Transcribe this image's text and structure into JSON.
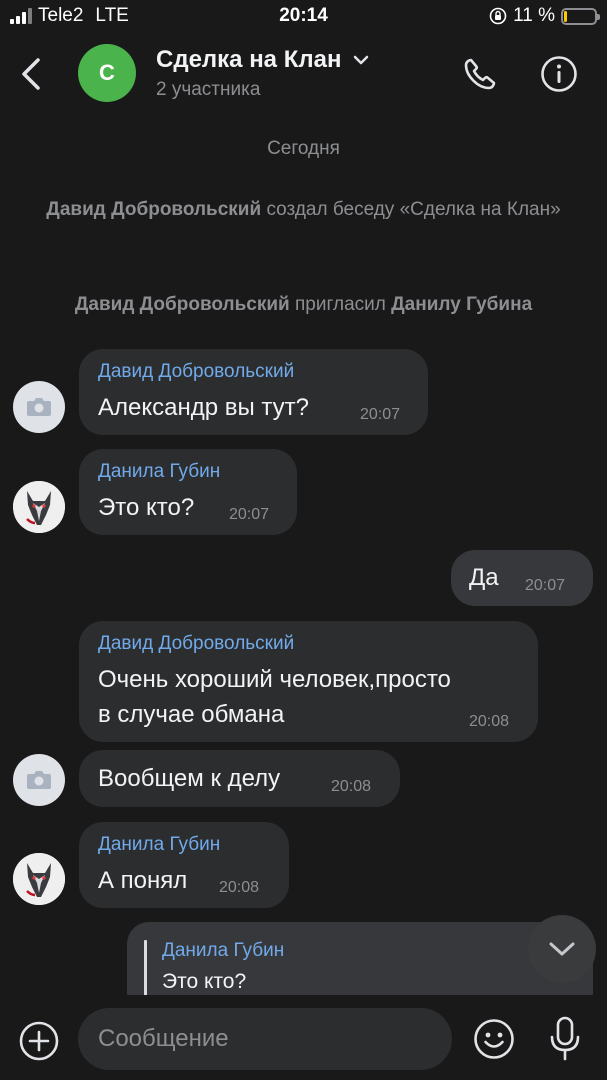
{
  "status_bar": {
    "carrier": "Tele2",
    "network": "LTE",
    "time": "20:14",
    "battery": "11 %",
    "battery_level": 0.11
  },
  "header": {
    "avatar_letter": "С",
    "title": "Сделка на Клан",
    "subtitle": "2 участника"
  },
  "system": {
    "date": "Сегодня",
    "created_actor": "Давид Добровольский",
    "created_text": "создал беседу «Сделка на Клан»",
    "invite_actor": "Давид Добровольский",
    "invite_text": "пригласил",
    "invite_target": "Данилу Губина"
  },
  "messages": [
    {
      "author": "Давид Добровольский",
      "text": "Александр вы тут?",
      "time": "20:07"
    },
    {
      "author": "Данила Губин",
      "text": "Это кто?",
      "time": "20:07"
    },
    {
      "author": "",
      "text": "Да",
      "time": "20:07"
    },
    {
      "author": "Давид Добровольский",
      "text": "Очень хороший человек,просто",
      "text2": "в случае обмана",
      "time": "20:08"
    },
    {
      "author": "",
      "text": "Вообщем к делу",
      "time": "20:08"
    },
    {
      "author": "Данила Губин",
      "text": "А понял",
      "time": "20:08"
    }
  ],
  "reply_preview": {
    "author": "Данила Губин",
    "text": "Это кто?"
  },
  "composer": {
    "placeholder": "Сообщение"
  },
  "colors": {
    "background": "#19191a",
    "bubble": "#2c2d2f",
    "author_link": "#71aaeb",
    "chat_avatar": "#4bb34b"
  },
  "icons": [
    "back-arrow-icon",
    "chevron-down-icon",
    "phone-icon",
    "info-icon",
    "camera-icon",
    "wolf-avatar",
    "plus-circle-icon",
    "emoji-icon",
    "microphone-icon"
  ]
}
